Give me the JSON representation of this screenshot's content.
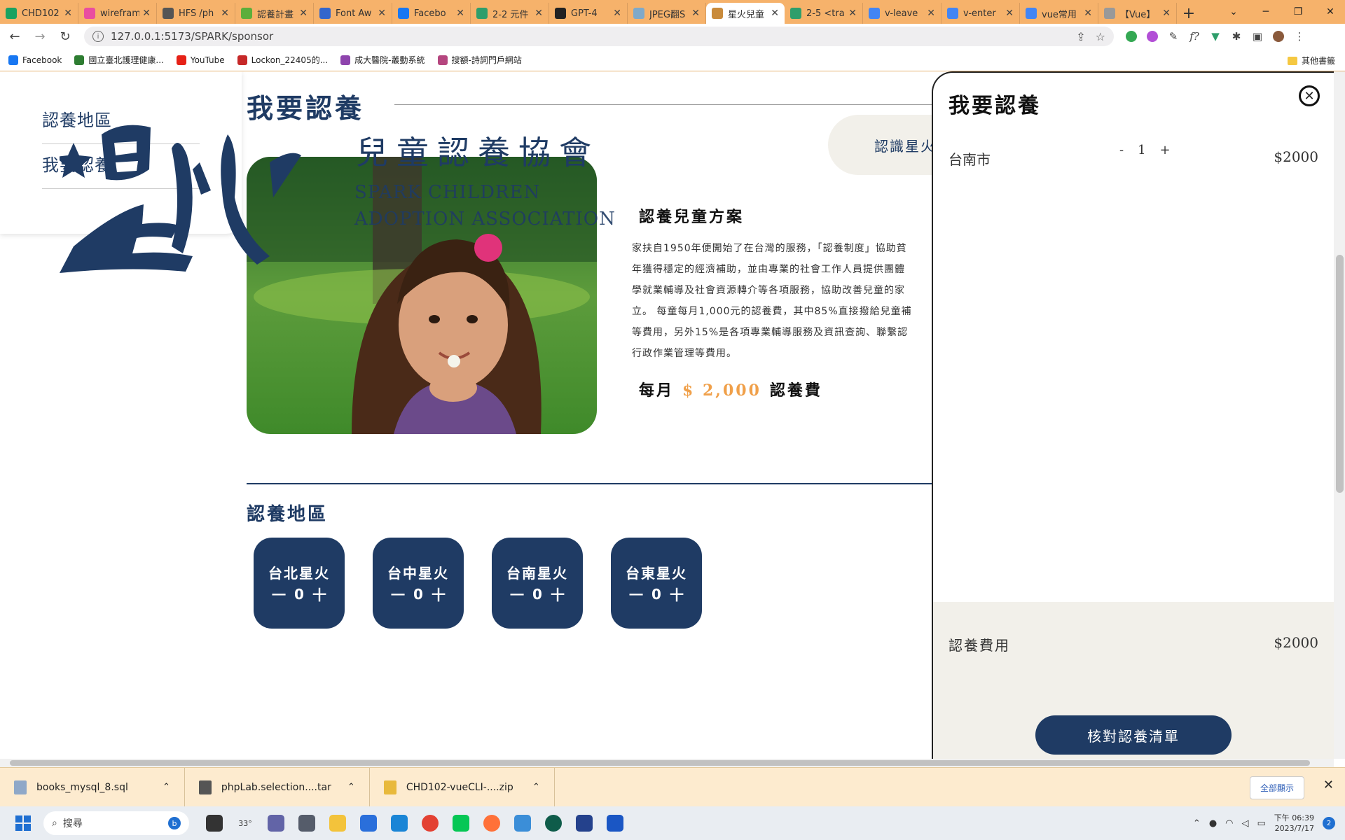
{
  "browser": {
    "tabs": [
      {
        "label": "CHD102",
        "color": "#1aa260"
      },
      {
        "label": "wirefram",
        "color": "#e94ea0"
      },
      {
        "label": "HFS /ph",
        "color": "#555555"
      },
      {
        "label": "認養計畫",
        "color": "#5cae3b"
      },
      {
        "label": "Font Aw",
        "color": "#3366cc"
      },
      {
        "label": "Facebo",
        "color": "#1877f2"
      },
      {
        "label": "2-2 元件",
        "color": "#2f9e6b"
      },
      {
        "label": "GPT-4",
        "color": "#222222"
      },
      {
        "label": "JPEG翻S",
        "color": "#7fa9c9"
      },
      {
        "label": "星火兒童",
        "color": "#c98b3b"
      },
      {
        "label": "2-5 <tra",
        "color": "#2f9e6b"
      },
      {
        "label": "v-leave",
        "color": "#4285f4"
      },
      {
        "label": "v-enter",
        "color": "#4285f4"
      },
      {
        "label": "vue常用",
        "color": "#4285f4"
      },
      {
        "label": "【Vue】",
        "color": "#999999"
      }
    ],
    "active_tab_index": 9,
    "new_tab": "+",
    "url": "127.0.0.1:5173/SPARK/sponsor",
    "bookmarks": [
      {
        "label": "Facebook",
        "color": "#1877f2"
      },
      {
        "label": "國立臺北護理健康...",
        "color": "#2e7d32"
      },
      {
        "label": "YouTube",
        "color": "#e62117"
      },
      {
        "label": "Lockon_22405的...",
        "color": "#c62828"
      },
      {
        "label": "成大醫院-叢動系統",
        "color": "#8e44ad"
      },
      {
        "label": "搜額-詩詞門戶網站",
        "color": "#b5467f"
      }
    ],
    "other_bookmarks": "其他書籤"
  },
  "site": {
    "side_menu": [
      "認養地區",
      "我要認養"
    ],
    "brand_title": "兒童認養協會",
    "brand_en_line1": "SPARK CHILDREN",
    "brand_en_line2": "ADOPTION ASSOCIATION",
    "page_heading": "我要認養",
    "nav_pill": "認識星火",
    "plan_title": "認養兒童方案",
    "plan_lines": [
      "家扶自1950年便開始了在台灣的服務，「認養制度」協助貧",
      "年獲得穩定的經濟補助，並由專業的社會工作人員提供團體",
      "學就業輔導及社會資源轉介等各項服務，協助改善兒童的家",
      "立。 每童每月1,000元的認養費，其中85%直接撥給兒童補",
      "等費用，另外15%是各項專業輔導服務及資訊查詢、聯繫認",
      "行政作業管理等費用。"
    ],
    "monthly_prefix": "每月",
    "monthly_amount": "$ 2,000",
    "monthly_suffix": "認養費",
    "region_heading": "認養地區",
    "regions": [
      {
        "name": "台北星火",
        "count": "0"
      },
      {
        "name": "台中星火",
        "count": "0"
      },
      {
        "name": "台南星火",
        "count": "0"
      },
      {
        "name": "台東星火",
        "count": "0"
      }
    ],
    "minus": "一",
    "plus": "十"
  },
  "drawer": {
    "title": "我要認養",
    "item": {
      "city": "台南市",
      "minus": "-",
      "qty": "1",
      "plus": "+",
      "price": "$2000"
    },
    "fee_label": "認養費用",
    "fee_value": "$2000",
    "checkout": "核對認養清單"
  },
  "downloads": {
    "items": [
      {
        "name": "books_mysql_8.sql",
        "color": "#8fa8c8"
      },
      {
        "name": "phpLab.selection....tar",
        "color": "#555555"
      },
      {
        "name": "CHD102-vueCLI-....zip",
        "color": "#e8b93c"
      }
    ],
    "show_all": "全部顯示"
  },
  "taskbar": {
    "search_placeholder": "搜尋",
    "weather": "33°",
    "time": "下午 06:39",
    "date": "2023/7/17",
    "notifications": "2"
  },
  "colors": {
    "brand_navy": "#1f3b64",
    "accent_orange": "#f0a04a",
    "tab_strip": "#f6b26b",
    "cream": "#f2f0ea"
  }
}
